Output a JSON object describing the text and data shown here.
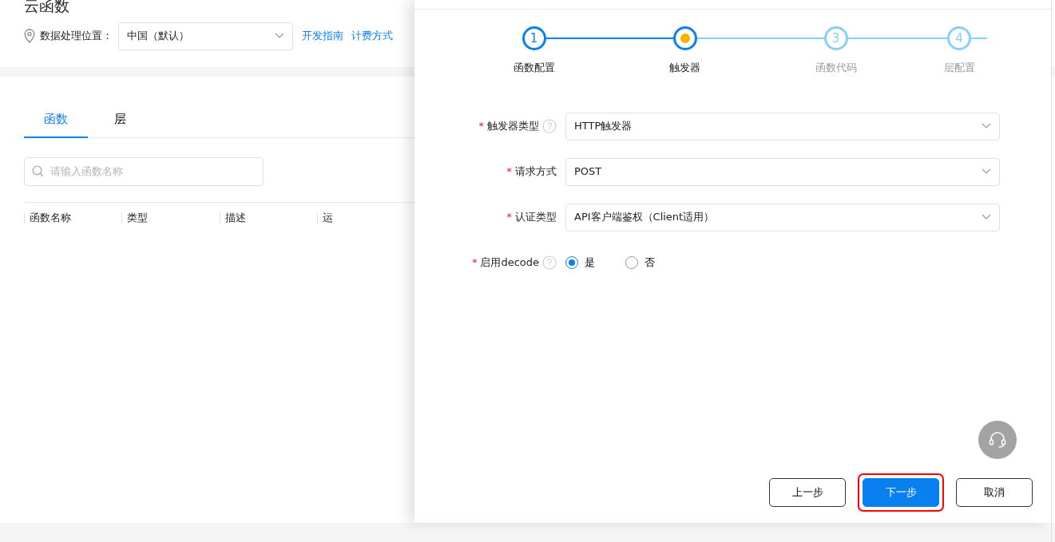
{
  "page": {
    "title": "云函数",
    "region_label": "数据处理位置：",
    "region_value": "中国（默认）",
    "links": [
      "开发指南",
      "计费方式"
    ],
    "tabs": [
      {
        "label": "函数",
        "selected": true
      },
      {
        "label": "层",
        "selected": false
      }
    ],
    "search": {
      "placeholder": "请输入函数名称"
    },
    "table": {
      "columns": [
        "函数名称",
        "类型",
        "描述",
        "运"
      ]
    }
  },
  "drawer": {
    "steps": [
      {
        "number": "1",
        "label": "函数配置",
        "kind": "done"
      },
      {
        "label": "触发器",
        "kind": "current"
      },
      {
        "number": "3",
        "label": "函数代码",
        "kind": "pending"
      },
      {
        "number": "4",
        "label": "层配置",
        "kind": "pending"
      }
    ],
    "fields": [
      {
        "kind": "select",
        "mark": "*",
        "label": "触发器类型",
        "help": true,
        "value": "HTTP触发器"
      },
      {
        "kind": "select",
        "mark": "*",
        "label": "请求方式",
        "help": false,
        "value": "POST"
      },
      {
        "kind": "select",
        "mark": "*",
        "label": "认证类型",
        "help": false,
        "value": "API客户端鉴权（Client适用）"
      },
      {
        "kind": "radio",
        "mark": "*",
        "label": "启用decode",
        "help": true,
        "options": [
          {
            "label": "是",
            "selected": true
          },
          {
            "label": "否",
            "selected": false
          }
        ]
      }
    ],
    "buttons": [
      {
        "label": "上一步",
        "kind": "default",
        "highlighted": false
      },
      {
        "label": "下一步",
        "kind": "primary",
        "highlighted": true
      },
      {
        "label": "取消",
        "kind": "default",
        "highlighted": false
      }
    ]
  }
}
